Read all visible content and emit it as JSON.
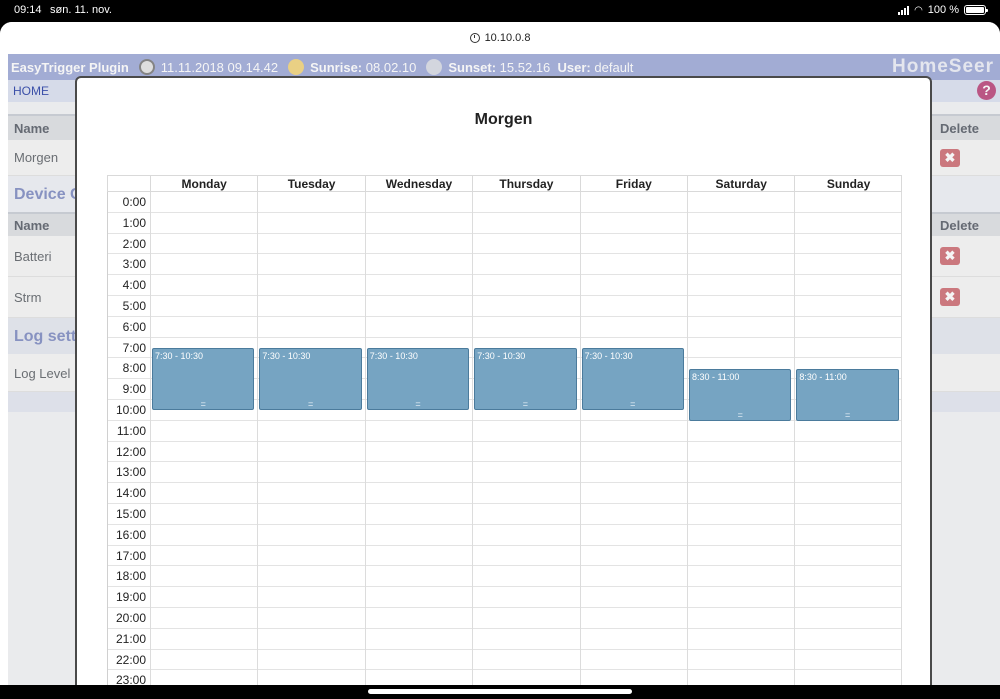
{
  "status": {
    "time": "09:14",
    "date": "søn. 11. nov.",
    "battery": "100 %"
  },
  "browser": {
    "url": "10.10.0.8"
  },
  "header": {
    "plugin": "EasyTrigger Plugin",
    "datetime": "11.11.2018 09.14.42",
    "sunrise_label": "Sunrise:",
    "sunrise": "08.02.10",
    "sunset_label": "Sunset:",
    "sunset": "15.52.16",
    "user_label": "User:",
    "user": "default",
    "logo": "HomeSeer"
  },
  "nav": {
    "home": "HOME",
    "help": "?"
  },
  "background": {
    "name_header": "Name",
    "delete_header": "Delete",
    "row_morgen": "Morgen",
    "section_device": "Device C",
    "row_batteri": "Batteri",
    "row_strm": "Strm",
    "section_log": "Log sett",
    "row_loglevel": "Log Level"
  },
  "modal": {
    "title": "Morgen",
    "days": [
      "Monday",
      "Tuesday",
      "Wednesday",
      "Thursday",
      "Friday",
      "Saturday",
      "Sunday"
    ],
    "hours": [
      "0:00",
      "1:00",
      "2:00",
      "3:00",
      "4:00",
      "5:00",
      "6:00",
      "7:00",
      "8:00",
      "9:00",
      "10:00",
      "11:00",
      "12:00",
      "13:00",
      "14:00",
      "15:00",
      "16:00",
      "17:00",
      "18:00",
      "19:00",
      "20:00",
      "21:00",
      "22:00",
      "23:00"
    ],
    "events": [
      {
        "day": "Monday",
        "label": "7:30 - 10:30",
        "start": 7.5,
        "end": 10.5
      },
      {
        "day": "Tuesday",
        "label": "7:30 - 10:30",
        "start": 7.5,
        "end": 10.5
      },
      {
        "day": "Wednesday",
        "label": "7:30 - 10:30",
        "start": 7.5,
        "end": 10.5
      },
      {
        "day": "Thursday",
        "label": "7:30 - 10:30",
        "start": 7.5,
        "end": 10.5
      },
      {
        "day": "Friday",
        "label": "7:30 - 10:30",
        "start": 7.5,
        "end": 10.5
      },
      {
        "day": "Saturday",
        "label": "8:30 - 11:00",
        "start": 8.5,
        "end": 11.0
      },
      {
        "day": "Sunday",
        "label": "8:30 - 11:00",
        "start": 8.5,
        "end": 11.0
      }
    ],
    "event_handle": "="
  },
  "colors": {
    "header_bg": "#a9b3dd",
    "event_bg": "#76a4c2",
    "delete_icon": "#d47d84"
  }
}
